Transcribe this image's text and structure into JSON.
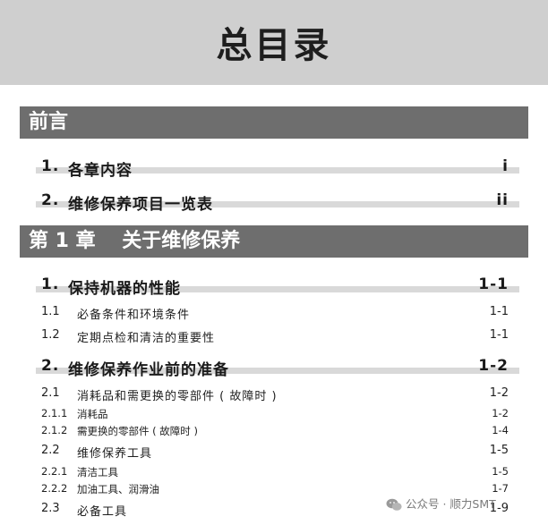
{
  "page_title": "总目录",
  "preface": {
    "title": "前言",
    "items": [
      {
        "num": "1.",
        "label": "各章内容",
        "page": "i"
      },
      {
        "num": "2.",
        "label": "维修保养项目一览表",
        "page": "ii"
      }
    ]
  },
  "chapter1": {
    "title": "第 1 章　 关于维修保养",
    "items": [
      {
        "num": "1.",
        "label": "保持机器的性能",
        "page": "1-1"
      },
      {
        "num": "1.1",
        "label": "必备条件和环境条件",
        "page": "1-1"
      },
      {
        "num": "1.2",
        "label": "定期点检和清洁的重要性",
        "page": "1-1"
      },
      {
        "num": "2.",
        "label": "维修保养作业前的准备",
        "page": "1-2"
      },
      {
        "num": "2.1",
        "label": "消耗品和需更换的零部件 ( 故障时 )",
        "page": "1-2"
      },
      {
        "num": "2.1.1",
        "label": "消耗品",
        "page": "1-2"
      },
      {
        "num": "2.1.2",
        "label": "需更换的零部件 ( 故障时 )",
        "page": "1-4"
      },
      {
        "num": "2.2",
        "label": "维修保养工具",
        "page": "1-5"
      },
      {
        "num": "2.2.1",
        "label": "清洁工具",
        "page": "1-5"
      },
      {
        "num": "2.2.2",
        "label": "加油工具、润滑油",
        "page": "1-7"
      },
      {
        "num": "2.3",
        "label": "必备工具",
        "page": "1-9"
      }
    ]
  },
  "watermark": {
    "text": "公众号 · 顺力SMT",
    "icon": "wechat-icon"
  }
}
